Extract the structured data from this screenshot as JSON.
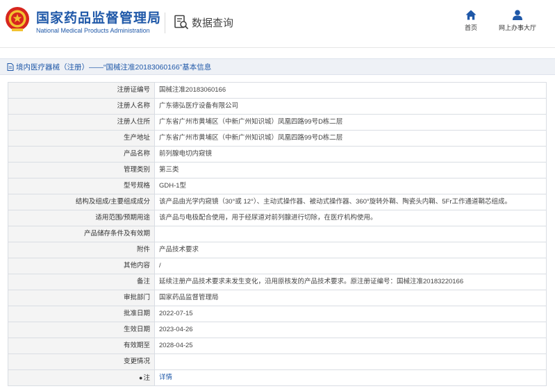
{
  "header": {
    "title": "国家药品监督管理局",
    "subtitle": "National Medical Products Administration",
    "query_label": "数据查询",
    "nav": [
      {
        "label": "首页",
        "icon": "home-icon"
      },
      {
        "label": "网上办事大厅",
        "icon": "user-icon"
      }
    ]
  },
  "breadcrumb": {
    "text": "境内医疗器械（注册）——“国械注准20183060166”基本信息"
  },
  "details": {
    "rows": [
      {
        "label": "注册证编号",
        "value": "国械注准20183060166"
      },
      {
        "label": "注册人名称",
        "value": "广东德弘医疗设备有限公司"
      },
      {
        "label": "注册人住所",
        "value": "广东省广州市黄埔区（中新广州知识城）凤凰四路99号D栋二层"
      },
      {
        "label": "生产地址",
        "value": "广东省广州市黄埔区（中新广州知识城）凤凰四路99号D栋二层"
      },
      {
        "label": "产品名称",
        "value": "前列腺电切内窥镜"
      },
      {
        "label": "管理类别",
        "value": "第三类"
      },
      {
        "label": "型号规格",
        "value": "GDH-1型"
      },
      {
        "label": "结构及组成/主要组成成分",
        "value": "该产品由光学内窥镜（30°或 12°）、主动式操作器、被动式操作器、360°旋转外鞘、陶瓷头内鞘、5Fr工作通道鞘芯组成。"
      },
      {
        "label": "适用范围/预期用途",
        "value": "该产品与电极配合使用，用于经尿道对前列腺进行切除，在医疗机构使用。"
      },
      {
        "label": "产品储存条件及有效期",
        "value": ""
      },
      {
        "label": "附件",
        "value": "产品技术要求"
      },
      {
        "label": "其他内容",
        "value": "/"
      },
      {
        "label": "备注",
        "value": "延续注册产品技术要求未发生变化，沿用原核发的产品技术要求。原注册证编号：国械注准20183220166"
      },
      {
        "label": "审批部门",
        "value": "国家药品监督管理局"
      },
      {
        "label": "批准日期",
        "value": "2022-07-15"
      },
      {
        "label": "生效日期",
        "value": "2023-04-26"
      },
      {
        "label": "有效期至",
        "value": "2028-04-25"
      },
      {
        "label": "变更情况",
        "value": ""
      }
    ],
    "note_label": "注",
    "note_link": "详情"
  },
  "colors": {
    "brand_blue": "#1f58a8",
    "label_bg": "#f4f4f4",
    "emblem_red": "#d7261e"
  }
}
